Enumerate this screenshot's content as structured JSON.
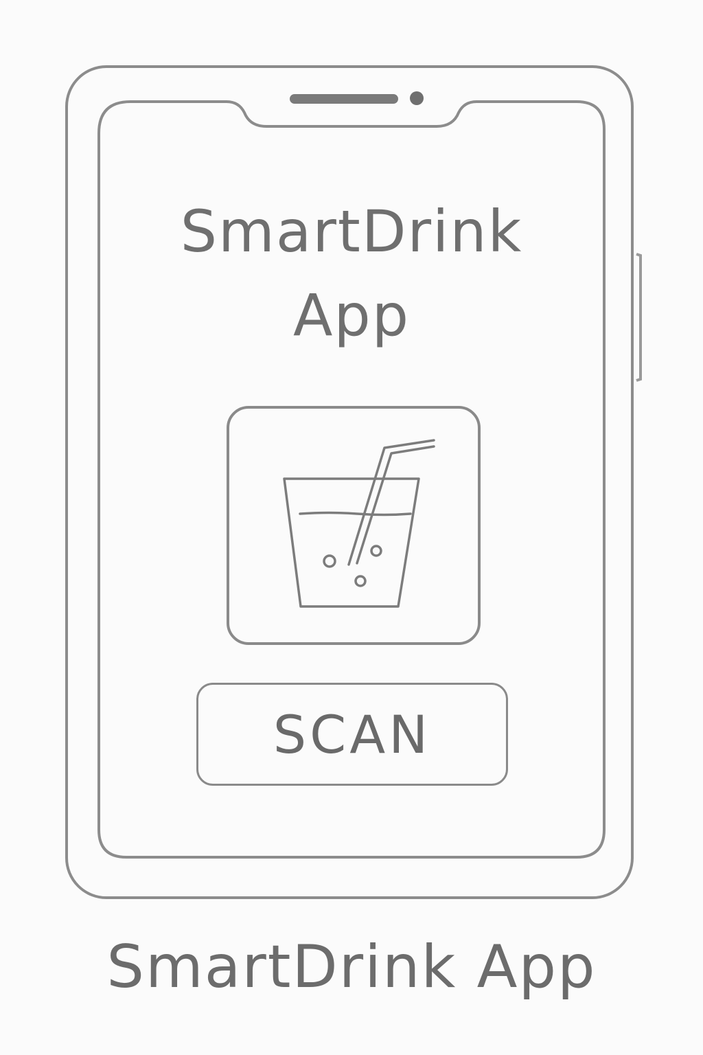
{
  "app": {
    "title_line1": "SmartDrink",
    "title_line2": "App"
  },
  "icon": {
    "name": "drink-glass-with-straw-icon"
  },
  "scan_button": {
    "label": "SCAN"
  },
  "caption": "SmartDrink App",
  "colors": {
    "stroke": "#8a8a8a",
    "text": "#6e6e6e",
    "background": "#fbfbfb"
  }
}
